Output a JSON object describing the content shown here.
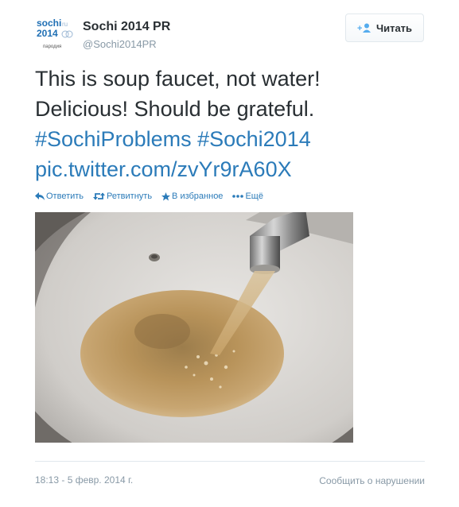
{
  "account": {
    "display_name": "Sochi 2014 PR",
    "handle": "@Sochi2014PR",
    "avatar_logo_text": [
      "sochi",
      "2014"
    ],
    "avatar_caption": "пародия"
  },
  "follow_button": {
    "label": "Читать",
    "icon": "add-user-icon"
  },
  "tweet": {
    "line1": "This is soup faucet, not water!",
    "line2": "Delicious! Should be grateful.",
    "hashtag1": "#SochiProblems",
    "hashtag2": "#Sochi2014",
    "pic_link": "pic.twitter.com/zvYr9rA60X"
  },
  "actions": {
    "reply": {
      "label": "Ответить",
      "icon": "reply-icon"
    },
    "retweet": {
      "label": "Ретвитнуть",
      "icon": "retweet-icon"
    },
    "favorite": {
      "label": "В избранное",
      "icon": "star-icon"
    },
    "more": {
      "label": "Ещё",
      "icon": "more-icon"
    }
  },
  "footer": {
    "timestamp": "18:13 - 5 февр. 2014 г.",
    "report_label": "Сообщить о нарушении"
  },
  "colors": {
    "link": "#2b7bb9",
    "text": "#292f33",
    "muted": "#8899a6",
    "logo_blue": "#1f6fb4",
    "water": "#b8935a"
  }
}
